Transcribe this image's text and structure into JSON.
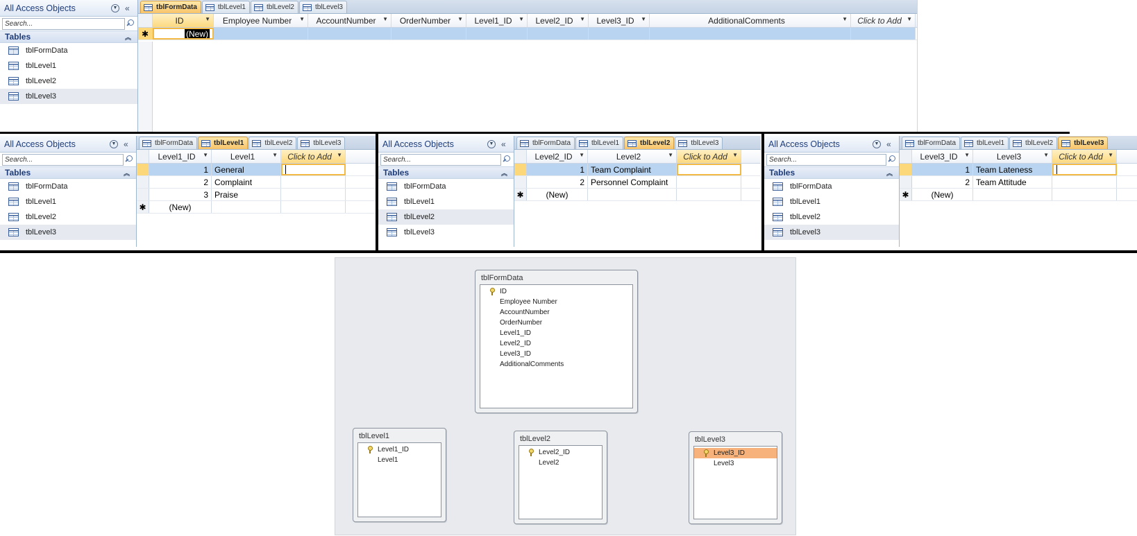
{
  "nav": {
    "title": "All Access Objects",
    "search_placeholder": "Search...",
    "group": "Tables",
    "items": [
      "tblFormData",
      "tblLevel1",
      "tblLevel2",
      "tblLevel3"
    ]
  },
  "tabs": [
    "tblFormData",
    "tblLevel1",
    "tblLevel2",
    "tblLevel3"
  ],
  "formdata": {
    "columns": [
      "ID",
      "Employee Number",
      "AccountNumber",
      "OrderNumber",
      "Level1_ID",
      "Level2_ID",
      "Level3_ID",
      "AdditionalComments",
      "Click to Add"
    ],
    "new_row": "(New)"
  },
  "level1": {
    "columns": [
      "Level1_ID",
      "Level1",
      "Click to Add"
    ],
    "rows": [
      {
        "id": "1",
        "name": "General"
      },
      {
        "id": "2",
        "name": "Complaint"
      },
      {
        "id": "3",
        "name": "Praise"
      }
    ],
    "new_row": "(New)"
  },
  "level2": {
    "columns": [
      "Level2_ID",
      "Level2",
      "Click to Add"
    ],
    "rows": [
      {
        "id": "1",
        "name": "Team Complaint"
      },
      {
        "id": "2",
        "name": "Personnel Complaint"
      }
    ],
    "new_row": "(New)"
  },
  "level3": {
    "columns": [
      "Level3_ID",
      "Level3",
      "Click to Add"
    ],
    "rows": [
      {
        "id": "1",
        "name": "Team Lateness"
      },
      {
        "id": "2",
        "name": "Team Attitude"
      }
    ],
    "new_row": "(New)"
  },
  "relationships": {
    "tblFormData": {
      "title": "tblFormData",
      "fields": [
        "ID",
        "Employee Number",
        "AccountNumber",
        "OrderNumber",
        "Level1_ID",
        "Level2_ID",
        "Level3_ID",
        "AdditionalComments"
      ]
    },
    "tblLevel1": {
      "title": "tblLevel1",
      "fields": [
        "Level1_ID",
        "Level1"
      ]
    },
    "tblLevel2": {
      "title": "tblLevel2",
      "fields": [
        "Level2_ID",
        "Level2"
      ]
    },
    "tblLevel3": {
      "title": "tblLevel3",
      "fields": [
        "Level3_ID",
        "Level3"
      ]
    }
  }
}
